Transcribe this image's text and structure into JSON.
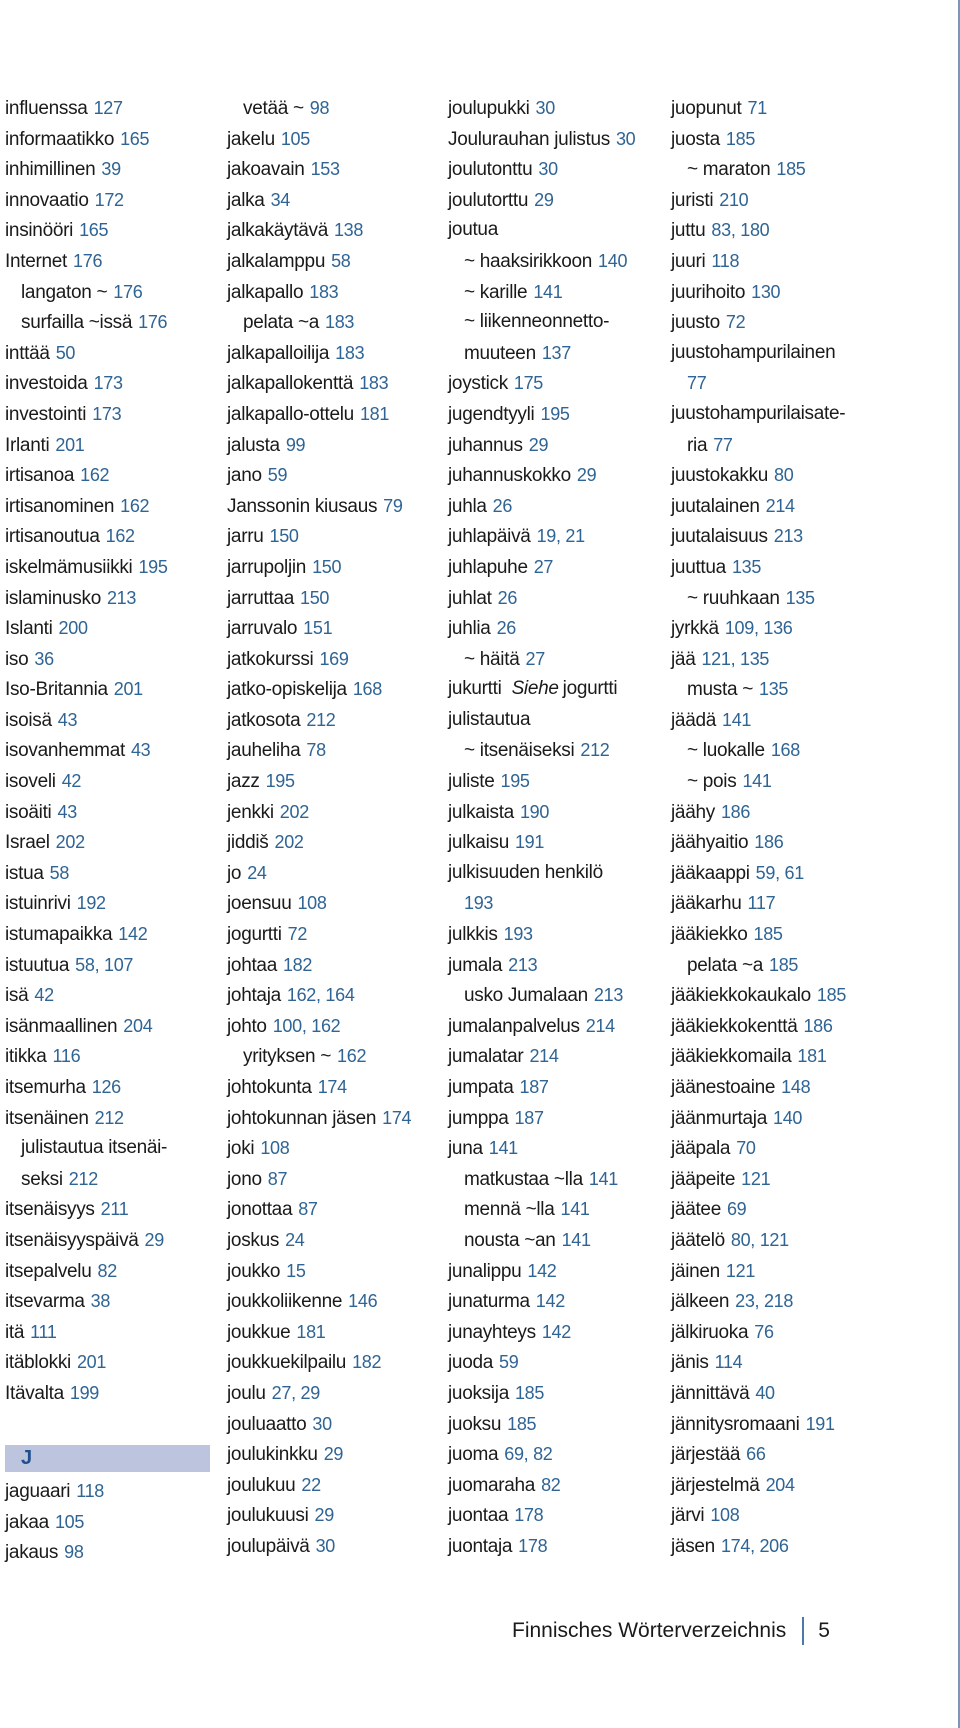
{
  "footer": {
    "title": "Finnisches Wörterverzeichnis",
    "page_number": "5"
  },
  "section_header": "J",
  "columns": [
    [
      {
        "term": "influenssa",
        "pages": "127"
      },
      {
        "term": "informaatikko",
        "pages": "165"
      },
      {
        "term": "inhimillinen",
        "pages": "39"
      },
      {
        "term": "innovaatio",
        "pages": "172"
      },
      {
        "term": "insinööri",
        "pages": "165"
      },
      {
        "term": "Internet",
        "pages": "176"
      },
      {
        "term": "langaton ~",
        "pages": "176",
        "sub": true
      },
      {
        "term": "surfailla ~issä",
        "pages": "176",
        "sub": true
      },
      {
        "term": "inttää",
        "pages": "50"
      },
      {
        "term": "investoida",
        "pages": "173"
      },
      {
        "term": "investointi",
        "pages": "173"
      },
      {
        "term": "Irlanti",
        "pages": "201"
      },
      {
        "term": "irtisanoa",
        "pages": "162"
      },
      {
        "term": "irtisanominen",
        "pages": "162"
      },
      {
        "term": "irtisanoutua",
        "pages": "162"
      },
      {
        "term": "iskelmämusiikki",
        "pages": "195"
      },
      {
        "term": "islaminusko",
        "pages": "213"
      },
      {
        "term": "Islanti",
        "pages": "200"
      },
      {
        "term": "iso",
        "pages": "36"
      },
      {
        "term": "Iso-Britannia",
        "pages": "201"
      },
      {
        "term": "isoisä",
        "pages": "43"
      },
      {
        "term": "isovanhemmat",
        "pages": "43"
      },
      {
        "term": "isoveli",
        "pages": "42"
      },
      {
        "term": "isoäiti",
        "pages": "43"
      },
      {
        "term": "Israel",
        "pages": "202"
      },
      {
        "term": "istua",
        "pages": "58"
      },
      {
        "term": "istuinrivi",
        "pages": "192"
      },
      {
        "term": "istumapaikka",
        "pages": "142"
      },
      {
        "term": "istuutua",
        "pages": "58, 107"
      },
      {
        "term": "isä",
        "pages": "42"
      },
      {
        "term": "isänmaallinen",
        "pages": "204"
      },
      {
        "term": "itikka",
        "pages": "116"
      },
      {
        "term": "itsemurha",
        "pages": "126"
      },
      {
        "term": "itsenäinen",
        "pages": "212"
      },
      {
        "term": "julistautua itsenäi-",
        "pages": "",
        "sub": true
      },
      {
        "term": "seksi",
        "pages": "212",
        "sub": true
      },
      {
        "term": "itsenäisyys",
        "pages": "211"
      },
      {
        "term": "itsenäisyyspäivä",
        "pages": "29"
      },
      {
        "term": "itsepalvelu",
        "pages": "82"
      },
      {
        "term": "itsevarma",
        "pages": "38"
      },
      {
        "term": "itä",
        "pages": "111"
      },
      {
        "term": "itäblokki",
        "pages": "201"
      },
      {
        "term": "Itävalta",
        "pages": "199"
      }
    ],
    [
      {
        "term": "vetää ~",
        "pages": "98",
        "sub": true
      },
      {
        "term": "jakelu",
        "pages": "105"
      },
      {
        "term": "jakoavain",
        "pages": "153"
      },
      {
        "term": "jalka",
        "pages": "34"
      },
      {
        "term": "jalkakäytävä",
        "pages": "138"
      },
      {
        "term": "jalkalamppu",
        "pages": "58"
      },
      {
        "term": "jalkapallo",
        "pages": "183"
      },
      {
        "term": "pelata ~a",
        "pages": "183",
        "sub": true
      },
      {
        "term": "jalkapalloilija",
        "pages": "183"
      },
      {
        "term": "jalkapallokenttä",
        "pages": "183"
      },
      {
        "term": "jalkapallo-ottelu",
        "pages": "181"
      },
      {
        "term": "jalusta",
        "pages": "99"
      },
      {
        "term": "jano",
        "pages": "59"
      },
      {
        "term": "Janssonin kiusaus",
        "pages": "79"
      },
      {
        "term": "jarru",
        "pages": "150"
      },
      {
        "term": "jarrupoljin",
        "pages": "150"
      },
      {
        "term": "jarruttaa",
        "pages": "150"
      },
      {
        "term": "jarruvalo",
        "pages": "151"
      },
      {
        "term": "jatkokurssi",
        "pages": "169"
      },
      {
        "term": "jatko-opiskelija",
        "pages": "168"
      },
      {
        "term": "jatkosota",
        "pages": "212"
      },
      {
        "term": "jauheliha",
        "pages": "78"
      },
      {
        "term": "jazz",
        "pages": "195"
      },
      {
        "term": "jenkki",
        "pages": "202"
      },
      {
        "term": "jiddiš",
        "pages": "202"
      },
      {
        "term": "jo",
        "pages": "24"
      },
      {
        "term": "joensuu",
        "pages": "108"
      },
      {
        "term": "jogurtti",
        "pages": "72"
      },
      {
        "term": "johtaa",
        "pages": "182"
      },
      {
        "term": "johtaja",
        "pages": "162, 164"
      },
      {
        "term": "johto",
        "pages": "100, 162"
      },
      {
        "term": "yrityksen ~",
        "pages": "162",
        "sub": true
      },
      {
        "term": "johtokunta",
        "pages": "174"
      },
      {
        "term": "johtokunnan jäsen",
        "pages": "174"
      },
      {
        "term": "joki",
        "pages": "108"
      },
      {
        "term": "jono",
        "pages": "87"
      },
      {
        "term": "jonottaa",
        "pages": "87"
      },
      {
        "term": "joskus",
        "pages": "24"
      },
      {
        "term": "joukko",
        "pages": "15"
      },
      {
        "term": "joukkoliikenne",
        "pages": "146"
      },
      {
        "term": "joukkue",
        "pages": "181"
      },
      {
        "term": "joukkuekilpailu",
        "pages": "182"
      },
      {
        "term": "joulu",
        "pages": "27, 29"
      },
      {
        "term": "jouluaatto",
        "pages": "30"
      },
      {
        "term": "joulukinkku",
        "pages": "29"
      },
      {
        "term": "joulukuu",
        "pages": "22"
      },
      {
        "term": "joulukuusi",
        "pages": "29"
      },
      {
        "term": "joulupäivä",
        "pages": "30"
      }
    ],
    [
      {
        "term": "joulupukki",
        "pages": "30"
      },
      {
        "term": "Joulurauhan julistus",
        "pages": "30"
      },
      {
        "term": "joulutonttu",
        "pages": "30"
      },
      {
        "term": "joulutorttu",
        "pages": "29"
      },
      {
        "term": "joutua",
        "pages": ""
      },
      {
        "term": "~ haaksirikkoon",
        "pages": "140",
        "sub": true
      },
      {
        "term": "~ karille",
        "pages": "141",
        "sub": true
      },
      {
        "term": "~ liikenneonnetto-",
        "pages": "",
        "sub": true
      },
      {
        "term": "muuteen",
        "pages": "137",
        "sub": true
      },
      {
        "term": "joystick",
        "pages": "175"
      },
      {
        "term": "jugendtyyli",
        "pages": "195"
      },
      {
        "term": "juhannus",
        "pages": "29"
      },
      {
        "term": "juhannuskokko",
        "pages": "29"
      },
      {
        "term": "juhla",
        "pages": "26"
      },
      {
        "term": "juhlapäivä",
        "pages": "19, 21"
      },
      {
        "term": "juhlapuhe",
        "pages": "27"
      },
      {
        "term": "juhlat",
        "pages": "26"
      },
      {
        "term": "juhlia",
        "pages": "26"
      },
      {
        "term": "~ häitä",
        "pages": "27",
        "sub": true
      },
      {
        "term": "jukurtti",
        "pages": "",
        "see_label": "Siehe",
        "see_target": "jogurtti"
      },
      {
        "term": "julistautua",
        "pages": ""
      },
      {
        "term": "~ itsenäiseksi",
        "pages": "212",
        "sub": true
      },
      {
        "term": "juliste",
        "pages": "195"
      },
      {
        "term": "julkaista",
        "pages": "190"
      },
      {
        "term": "julkaisu",
        "pages": "191"
      },
      {
        "term": "julkisuuden henkilö",
        "pages": ""
      },
      {
        "term": "",
        "pages": "193",
        "sub": true
      },
      {
        "term": "julkkis",
        "pages": "193"
      },
      {
        "term": "jumala",
        "pages": "213"
      },
      {
        "term": "usko Jumalaan",
        "pages": "213",
        "sub": true
      },
      {
        "term": "jumalanpalvelus",
        "pages": "214"
      },
      {
        "term": "jumalatar",
        "pages": "214"
      },
      {
        "term": "jumpata",
        "pages": "187"
      },
      {
        "term": "jumppa",
        "pages": "187"
      },
      {
        "term": "juna",
        "pages": "141"
      },
      {
        "term": "matkustaa ~lla",
        "pages": "141",
        "sub": true
      },
      {
        "term": "mennä ~lla",
        "pages": "141",
        "sub": true
      },
      {
        "term": "nousta ~an",
        "pages": "141",
        "sub": true
      },
      {
        "term": "junalippu",
        "pages": "142"
      },
      {
        "term": "junaturma",
        "pages": "142"
      },
      {
        "term": "junayhteys",
        "pages": "142"
      },
      {
        "term": "juoda",
        "pages": "59"
      },
      {
        "term": "juoksija",
        "pages": "185"
      },
      {
        "term": "juoksu",
        "pages": "185"
      },
      {
        "term": "juoma",
        "pages": "69, 82"
      },
      {
        "term": "juomaraha",
        "pages": "82"
      },
      {
        "term": "juontaa",
        "pages": "178"
      },
      {
        "term": "juontaja",
        "pages": "178"
      }
    ],
    [
      {
        "term": "juopunut",
        "pages": "71"
      },
      {
        "term": "juosta",
        "pages": "185"
      },
      {
        "term": "~ maraton",
        "pages": "185",
        "sub": true
      },
      {
        "term": "juristi",
        "pages": "210"
      },
      {
        "term": "juttu",
        "pages": "83, 180"
      },
      {
        "term": "juuri",
        "pages": "118"
      },
      {
        "term": "juurihoito",
        "pages": "130"
      },
      {
        "term": "juusto",
        "pages": "72"
      },
      {
        "term": "juustohampurilainen",
        "pages": ""
      },
      {
        "term": "",
        "pages": "77",
        "sub": true
      },
      {
        "term": "juustohampurilaisate-",
        "pages": ""
      },
      {
        "term": "ria",
        "pages": "77",
        "sub": true
      },
      {
        "term": "juustokakku",
        "pages": "80"
      },
      {
        "term": "juutalainen",
        "pages": "214"
      },
      {
        "term": "juutalaisuus",
        "pages": "213"
      },
      {
        "term": "juuttua",
        "pages": "135"
      },
      {
        "term": "~ ruuhkaan",
        "pages": "135",
        "sub": true
      },
      {
        "term": "jyrkkä",
        "pages": "109, 136"
      },
      {
        "term": "jää",
        "pages": "121, 135"
      },
      {
        "term": "musta ~",
        "pages": "135",
        "sub": true
      },
      {
        "term": "jäädä",
        "pages": "141"
      },
      {
        "term": "~ luokalle",
        "pages": "168",
        "sub": true
      },
      {
        "term": "~ pois",
        "pages": "141",
        "sub": true
      },
      {
        "term": "jäähy",
        "pages": "186"
      },
      {
        "term": "jäähyaitio",
        "pages": "186"
      },
      {
        "term": "jääkaappi",
        "pages": "59, 61"
      },
      {
        "term": "jääkarhu",
        "pages": "117"
      },
      {
        "term": "jääkiekko",
        "pages": "185"
      },
      {
        "term": "pelata ~a",
        "pages": "185",
        "sub": true
      },
      {
        "term": "jääkiekkokaukalo",
        "pages": "185"
      },
      {
        "term": "jääkiekkokenttä",
        "pages": "186"
      },
      {
        "term": "jääkiekkomaila",
        "pages": "181"
      },
      {
        "term": "jäänestoaine",
        "pages": "148"
      },
      {
        "term": "jäänmurtaja",
        "pages": "140"
      },
      {
        "term": "jääpala",
        "pages": "70"
      },
      {
        "term": "jääpeite",
        "pages": "121"
      },
      {
        "term": "jäätee",
        "pages": "69"
      },
      {
        "term": "jäätelö",
        "pages": "80, 121"
      },
      {
        "term": "jäinen",
        "pages": "121"
      },
      {
        "term": "jälkeen",
        "pages": "23, 218"
      },
      {
        "term": "jälkiruoka",
        "pages": "76"
      },
      {
        "term": "jänis",
        "pages": "114"
      },
      {
        "term": "jännittävä",
        "pages": "40"
      },
      {
        "term": "jännitysromaani",
        "pages": "191"
      },
      {
        "term": "järjestää",
        "pages": "66"
      },
      {
        "term": "järjestelmä",
        "pages": "204"
      },
      {
        "term": "järvi",
        "pages": "108"
      },
      {
        "term": "jäsen",
        "pages": "174, 206"
      }
    ]
  ],
  "column_1_after_header": [
    {
      "term": "jaguaari",
      "pages": "118"
    },
    {
      "term": "jakaa",
      "pages": "105"
    },
    {
      "term": "jakaus",
      "pages": "98"
    }
  ]
}
